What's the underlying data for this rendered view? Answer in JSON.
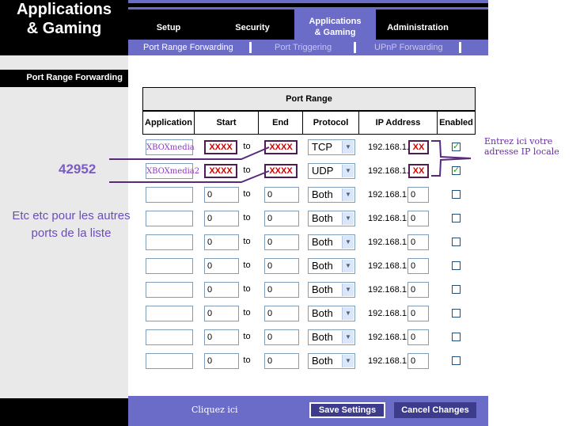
{
  "header": {
    "title_line1": "Applications",
    "title_line2": "& Gaming",
    "tabs": [
      "Setup",
      "Security",
      "Applications",
      "& Gaming",
      "Administration"
    ],
    "subnav": [
      "Port Range Forwarding",
      "Port Triggering",
      "UPnP Forwarding"
    ]
  },
  "section_label": "Port Range Forwarding",
  "table": {
    "group_header": "Port Range",
    "columns": [
      "Application",
      "Start",
      "End",
      "Protocol",
      "IP Address",
      "Enabled"
    ],
    "to_label": "to",
    "ip_prefix": "192.168.1.",
    "rows": [
      {
        "app": "XBOXmedia",
        "start": "XXXX",
        "end": "XXXX",
        "protocol": "TCP",
        "ip": "XX",
        "enabled": true
      },
      {
        "app": "XBOXmedia2",
        "start": "XXXX",
        "end": "XXXX",
        "protocol": "UDP",
        "ip": "XX",
        "enabled": true
      },
      {
        "app": "",
        "start": "0",
        "end": "0",
        "protocol": "Both",
        "ip": "0",
        "enabled": false
      },
      {
        "app": "",
        "start": "0",
        "end": "0",
        "protocol": "Both",
        "ip": "0",
        "enabled": false
      },
      {
        "app": "",
        "start": "0",
        "end": "0",
        "protocol": "Both",
        "ip": "0",
        "enabled": false
      },
      {
        "app": "",
        "start": "0",
        "end": "0",
        "protocol": "Both",
        "ip": "0",
        "enabled": false
      },
      {
        "app": "",
        "start": "0",
        "end": "0",
        "protocol": "Both",
        "ip": "0",
        "enabled": false
      },
      {
        "app": "",
        "start": "0",
        "end": "0",
        "protocol": "Both",
        "ip": "0",
        "enabled": false
      },
      {
        "app": "",
        "start": "0",
        "end": "0",
        "protocol": "Both",
        "ip": "0",
        "enabled": false
      },
      {
        "app": "",
        "start": "0",
        "end": "0",
        "protocol": "Both",
        "ip": "0",
        "enabled": false
      }
    ]
  },
  "annotations": {
    "port_number": "42952",
    "etc_line1": "Etc etc pour les autres",
    "etc_line2": "ports de la liste",
    "ip_note_line1": "Entrez ici votre",
    "ip_note_line2": "adresse IP locale",
    "click_here": "Cliquez ici"
  },
  "footer": {
    "save_label": "Save Settings",
    "cancel_label": "Cancel Changes"
  },
  "colors": {
    "accent": "#6b6bc8",
    "button": "#3c3b8c",
    "annotation": "#7c5cc4",
    "mask_text": "#d40000"
  }
}
